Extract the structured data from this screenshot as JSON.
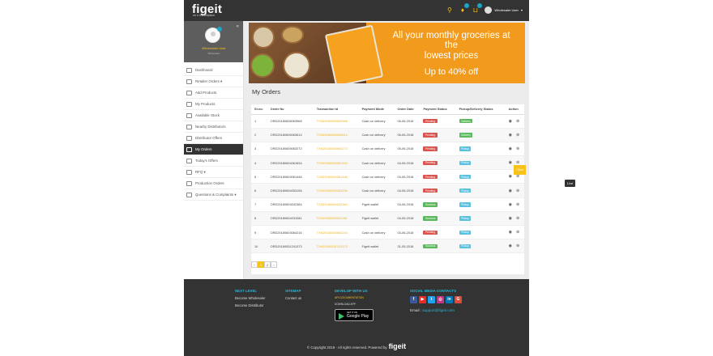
{
  "header": {
    "logo": "figeit",
    "tagline": "an e-marketplace",
    "user": "Wholesaler User"
  },
  "sidebar": {
    "profile_name": "Wholesaler User",
    "profile_role": "Wholesaler",
    "items": [
      {
        "label": "Dashboard"
      },
      {
        "label": "Retailer Orders ▾"
      },
      {
        "label": "Add Products"
      },
      {
        "label": "My Products"
      },
      {
        "label": "Available Stock"
      },
      {
        "label": "Nearby Distributors"
      },
      {
        "label": "Distributor Offers"
      },
      {
        "label": "My Orders"
      },
      {
        "label": "Today's Offers"
      },
      {
        "label": "RFQ ▾"
      },
      {
        "label": "Production Orders"
      },
      {
        "label": "Questions & Complaints ▾"
      }
    ]
  },
  "banner": {
    "line1": "All your monthly groceries at the",
    "line2": "lowest prices",
    "line3": "Up to 40% off"
  },
  "page_title": "My Orders",
  "table": {
    "headers": [
      "Sr.no.",
      "Order No",
      "Transaction Id",
      "Payment Mode",
      "Order Date",
      "Payment Status",
      "Pickup/Delivery Status",
      "Action"
    ],
    "rows": [
      {
        "sr": "1",
        "order": "ORD20180606063968",
        "txn": "TXN20180606063968",
        "mode": "Cash on delivery",
        "date": "06-06-2018",
        "pay": "Pending",
        "pay_color": "#d9534f",
        "deliv": "Delivery",
        "deliv_color": "#5cb85c"
      },
      {
        "sr": "2",
        "order": "ORD20180606063614",
        "txn": "TXN20180606063614",
        "mode": "Cash on delivery",
        "date": "06-06-2018",
        "pay": "Pending",
        "pay_color": "#d9534f",
        "deliv": "Delivery",
        "deliv_color": "#5cb85c"
      },
      {
        "sr": "3",
        "order": "ORD20180605063272",
        "txn": "TXN20180605063272",
        "mode": "Cash on delivery",
        "date": "05-06-2018",
        "pay": "Pending",
        "pay_color": "#d9534f",
        "deliv": "Pickup",
        "deliv_color": "#5bc0de"
      },
      {
        "sr": "4",
        "order": "ORD20180604061634",
        "txn": "TXN20180604061634",
        "mode": "Cash on delivery",
        "date": "04-06-2018",
        "pay": "Pending",
        "pay_color": "#d9534f",
        "deliv": "Pickup",
        "deliv_color": "#5bc0de"
      },
      {
        "sr": "5",
        "order": "ORD20180604061446",
        "txn": "TXN20180604061446",
        "mode": "Cash on delivery",
        "date": "04-06-2018",
        "pay": "Pending",
        "pay_color": "#d9534f",
        "deliv": "Pickup",
        "deliv_color": "#5bc0de"
      },
      {
        "sr": "6",
        "order": "ORD20180604053156",
        "txn": "TXN20180604053156",
        "mode": "Cash on delivery",
        "date": "04-06-2018",
        "pay": "Pending",
        "pay_color": "#d9534f",
        "deliv": "Pickup",
        "deliv_color": "#5bc0de"
      },
      {
        "sr": "7",
        "order": "ORD20180604042384",
        "txn": "TXN20180604042384",
        "mode": "Figeit wallet",
        "date": "04-06-2018",
        "pay": "Success",
        "pay_color": "#5cb85c",
        "deliv": "Pickup",
        "deliv_color": "#5bc0de"
      },
      {
        "sr": "8",
        "order": "ORD20180604031081",
        "txn": "TXN20180604031081",
        "mode": "Figeit wallet",
        "date": "04-06-2018",
        "pay": "Success",
        "pay_color": "#5cb85c",
        "deliv": "Pickup",
        "deliv_color": "#5bc0de"
      },
      {
        "sr": "9",
        "order": "ORD20180603064216",
        "txn": "TXN20180603064216",
        "mode": "Cash on delivery",
        "date": "03-06-2018",
        "pay": "Pending",
        "pay_color": "#d9534f",
        "deliv": "Pickup",
        "deliv_color": "#5bc0de"
      },
      {
        "sr": "10",
        "order": "ORD20180531241373",
        "txn": "TXN20180531241373",
        "mode": "Figeit wallet",
        "date": "31-05-2018",
        "pay": "Success",
        "pay_color": "#5cb85c",
        "deliv": "Pickup",
        "deliv_color": "#5bc0de"
      }
    ]
  },
  "pager": {
    "prev": "‹",
    "p1": "1",
    "p2": "2",
    "next": "›"
  },
  "live_label": "Live",
  "chat_label": "Chat",
  "footer": {
    "col1_head": "NEXT LEVEL",
    "col1_links": [
      "Become Wholesaler",
      "Become Distributor"
    ],
    "col2_head": "SITEMAP",
    "col2_links": [
      "Contact us"
    ],
    "col3_head": "DEVELOP WITH US",
    "api": "API DOCUMENTATION",
    "download": "DOWNLOAD APP",
    "getiton": "GET IT ON",
    "gplay": "Google Play",
    "col4_head": "SOCIAL MEDIA CONTACTS",
    "email_label": "Email :",
    "email": "support@figeit.com",
    "copyright": "© Copyright 2018 - All rights reserved. Powered by",
    "brand": "figeit"
  }
}
